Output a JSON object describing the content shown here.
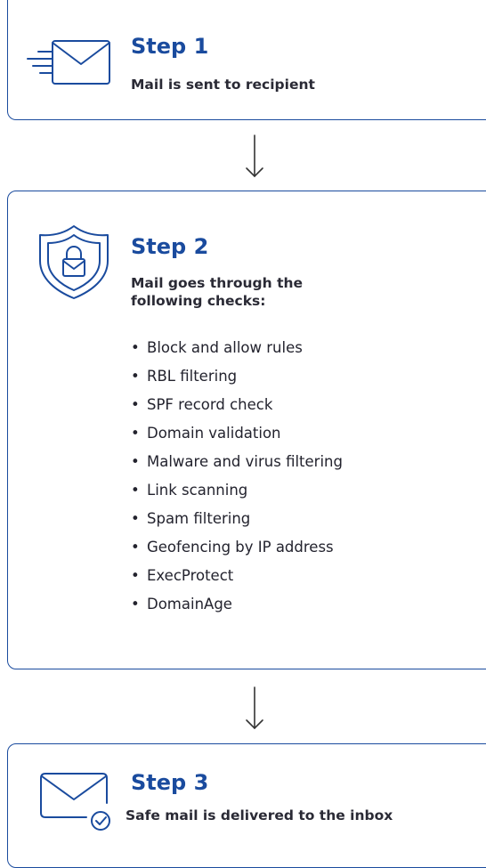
{
  "steps": [
    {
      "title": "Step 1",
      "description": "Mail is sent to recipient",
      "icon": "mail-sent-icon"
    },
    {
      "title": "Step 2",
      "description": "Mail goes through the following checks:",
      "icon": "shield-lock-icon",
      "checks": [
        "Block and allow rules",
        "RBL filtering",
        "SPF record check",
        "Domain validation",
        "Malware and virus filtering",
        "Link scanning",
        "Spam filtering",
        "Geofencing by IP address",
        "ExecProtect",
        "DomainAge"
      ]
    },
    {
      "title": "Step 3",
      "description": "Safe mail is delivered to the inbox",
      "icon": "mail-check-icon"
    }
  ],
  "colors": {
    "accent": "#1a4b9e",
    "text": "#23232e",
    "background": "#ffffff"
  }
}
